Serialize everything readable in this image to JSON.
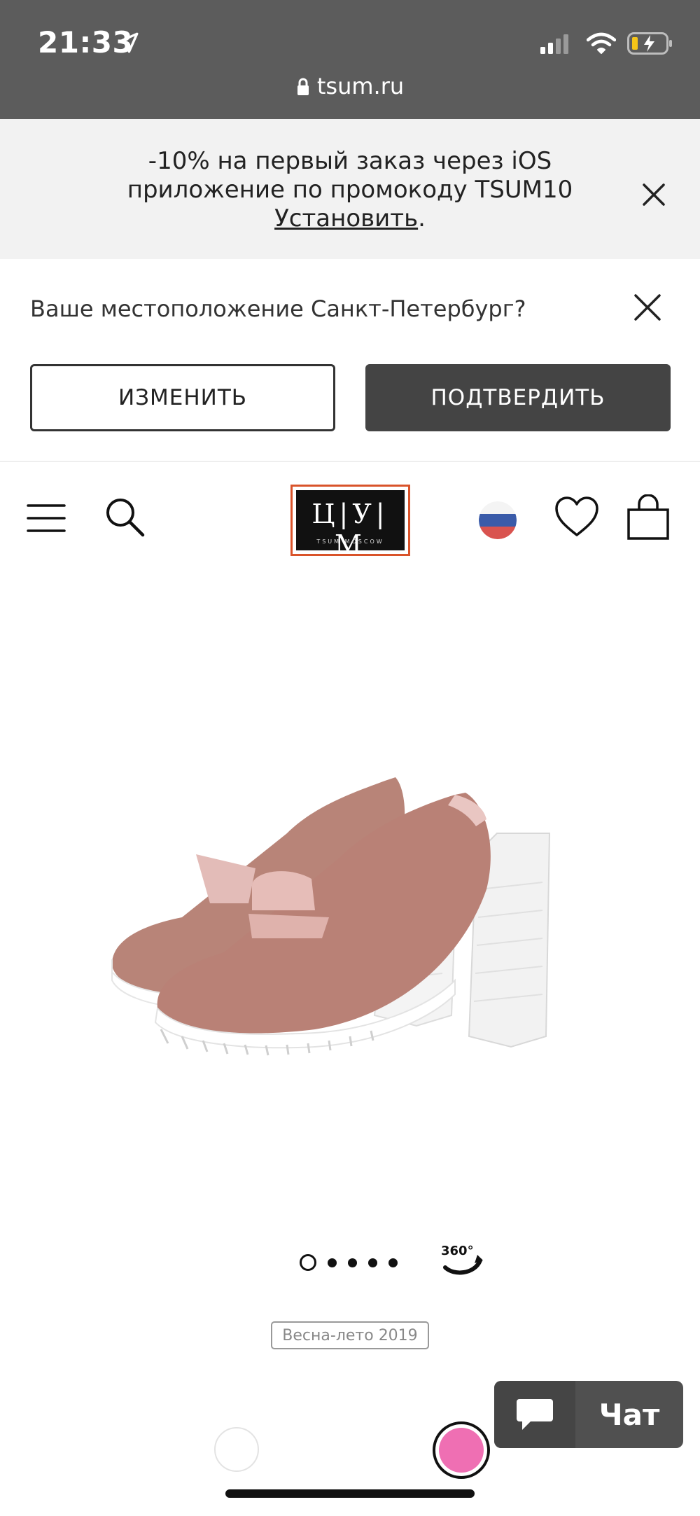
{
  "status_bar": {
    "time": "21:33",
    "url": "tsum.ru",
    "icons": [
      "location-arrow-icon",
      "signal-icon",
      "wifi-icon",
      "battery-charging-icon",
      "lock-icon"
    ]
  },
  "promo": {
    "text": "-10% на первый заказ через iOS приложение по промокоду TSUM10 ",
    "link_label": "Установить",
    "suffix": "."
  },
  "location": {
    "question": "Ваше местоположение Санкт-Петербург?",
    "change_label": "ИЗМЕНИТЬ",
    "confirm_label": "ПОДТВЕРДИТЬ"
  },
  "header": {
    "logo_letters": "Ц|У|М",
    "logo_sub": "TSUM MOSCOW",
    "icons": [
      "menu-icon",
      "search-icon",
      "russia-flag-icon",
      "heart-icon",
      "bag-icon"
    ]
  },
  "product": {
    "image_name": "shoe-loafer-pumps",
    "gallery_pages": 5,
    "gallery_active_index": 0,
    "view_360_label": "360°",
    "season": "Весна-лето 2019",
    "colors": [
      "#ffffff",
      "#ef6fb3"
    ],
    "selected_color_index": 1
  },
  "chat": {
    "label": "Чат"
  },
  "colors": {
    "statusbar_bg": "#5c5c5c",
    "promo_bg": "#f2f2f2",
    "confirm_bg": "#444444",
    "logo_border": "#d9532a",
    "chat_bg": "#505050"
  }
}
